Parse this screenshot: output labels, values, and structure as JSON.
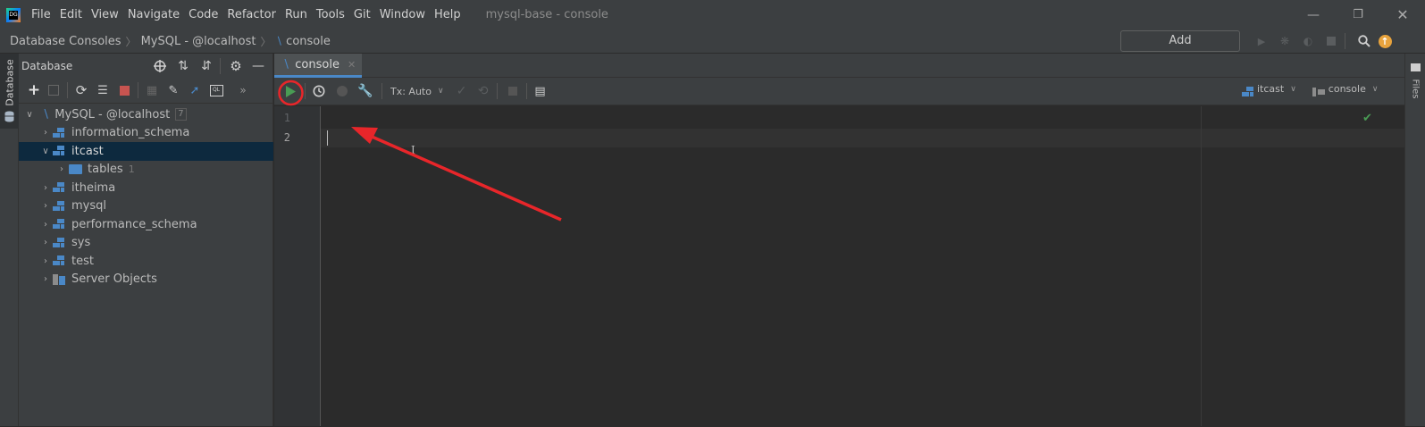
{
  "menubar": {
    "items": [
      "File",
      "Edit",
      "View",
      "Navigate",
      "Code",
      "Refactor",
      "Run",
      "Tools",
      "Git",
      "Window",
      "Help"
    ],
    "title": "mysql-base - console"
  },
  "navbar": {
    "breadcrumbs": [
      "Database Consoles",
      "MySQL - @localhost",
      "console"
    ],
    "add_config_label": "Add Configuration..."
  },
  "db_panel": {
    "title": "Database",
    "stripe_label": "Database",
    "tree": {
      "root": {
        "label": "MySQL - @localhost",
        "count": "7"
      },
      "items": [
        {
          "label": "information_schema"
        },
        {
          "label": "itcast"
        },
        {
          "label": "tables",
          "count": "1"
        },
        {
          "label": "itheima"
        },
        {
          "label": "mysql"
        },
        {
          "label": "performance_schema"
        },
        {
          "label": "sys"
        },
        {
          "label": "test"
        },
        {
          "label": "Server Objects"
        }
      ]
    }
  },
  "editor": {
    "tab_label": "console",
    "tx_label": "Tx: Auto",
    "schema_selector": "itcast",
    "session_selector": "console",
    "line_numbers": [
      "1",
      "2"
    ]
  },
  "right_stripe": {
    "files_label": "Files"
  },
  "colors": {
    "accent_blue": "#4a88c7",
    "run_green": "#499c54",
    "annotation_red": "#e8262a"
  }
}
